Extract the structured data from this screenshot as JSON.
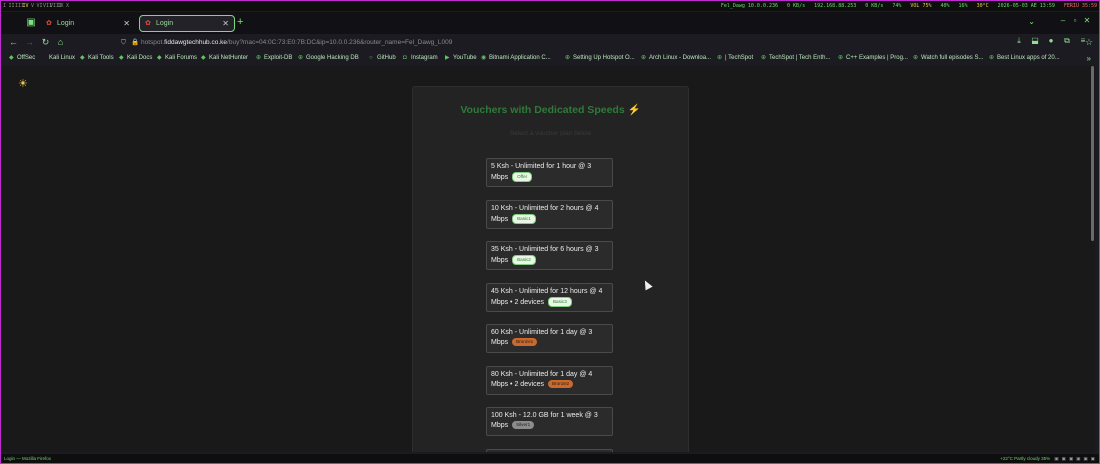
{
  "system_bar": {
    "workspaces": [
      "I",
      "II",
      "III",
      "IV",
      "V",
      "VI",
      "VII",
      "VIII",
      "IX",
      "X"
    ],
    "active_workspace_index": 3,
    "host": "Fel_Dawg 10.0.0.236",
    "net_down": "0 KB/s",
    "ip": "192.168.88.253",
    "net_up": "0 KB/s",
    "wifi": "74%",
    "volume": "VOL 75%",
    "cpu": "40%",
    "mem": "16%",
    "temp": "30°C",
    "datetime": "2026-05-03 AE 13:59",
    "fbattery": "FERIU 35:59"
  },
  "browser": {
    "tabs": [
      {
        "label": "Login",
        "active": false
      },
      {
        "label": "Login",
        "active": true
      }
    ],
    "url_prefix": "hotspot.",
    "url_domain": "fiddawgtechhub.co.ke",
    "url_path": "/buy?mac=04:0C:73:E0:7B:DC&ip=10.0.0.236&router_name=Fel_Dawg_L009",
    "bookmarks": [
      "OffSec",
      "Kali Linux",
      "Kali Tools",
      "Kali Docs",
      "Kali Forums",
      "Kali NetHunter",
      "Exploit-DB",
      "Google Hacking DB",
      "GitHub",
      "Instagram",
      "YouTube",
      "Bitnami Application C...",
      "Setting Up Hotspot O...",
      "Arch Linux - Downloa...",
      "| TechSpot",
      "TechSpot | Tech Enth...",
      "C++ Examples | Prog...",
      "Watch full episodes S...",
      "Best Linux apps of 20..."
    ]
  },
  "page": {
    "title": "Vouchers with Dedicated Speeds",
    "title_icon": "⚡",
    "subtitle": "Select a voucher plan below",
    "vouchers": [
      {
        "label": "5 Ksh - Unlimited for 1 hour @ 3 Mbps",
        "badge": "Offer",
        "badge_color": "green"
      },
      {
        "label": "10 Ksh - Unlimited for 2 hours @ 4 Mbps",
        "badge": "Basic1",
        "badge_color": "green"
      },
      {
        "label": "35 Ksh - Unlimited for 6 hours @ 3 Mbps",
        "badge": "Basic2",
        "badge_color": "green"
      },
      {
        "label": "45 Ksh - Unlimited for 12 hours @ 4 Mbps • 2 devices",
        "badge": "Basic3",
        "badge_color": "green"
      },
      {
        "label": "60 Ksh - Unlimited for 1 day @ 3 Mbps",
        "badge": "Bronze1",
        "badge_color": "orange"
      },
      {
        "label": "80 Ksh - Unlimited for 1 day @ 4 Mbps • 2 devices",
        "badge": "Bronze2",
        "badge_color": "orange"
      },
      {
        "label": "100 Ksh - 12.0 GB for 1 week @ 3 Mbps",
        "badge": "Silver1",
        "badge_color": "silver"
      }
    ]
  },
  "statusbar": {
    "left": "Login — Mozilla Firefox",
    "right": "+22°C Partly cloudy 35%"
  },
  "colors": {
    "accent_green": "#2f7a3a",
    "frame": "#c02bd1",
    "badge_orange": "#c9692d"
  }
}
